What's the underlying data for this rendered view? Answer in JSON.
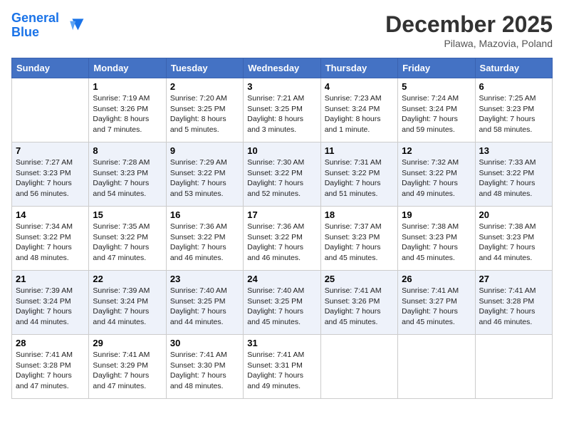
{
  "logo": {
    "line1": "General",
    "line2": "Blue"
  },
  "title": "December 2025",
  "location": "Pilawa, Mazovia, Poland",
  "days_of_week": [
    "Sunday",
    "Monday",
    "Tuesday",
    "Wednesday",
    "Thursday",
    "Friday",
    "Saturday"
  ],
  "weeks": [
    [
      {
        "day": "",
        "sunrise": "",
        "sunset": "",
        "daylight": ""
      },
      {
        "day": "1",
        "sunrise": "7:19 AM",
        "sunset": "3:26 PM",
        "daylight": "8 hours and 7 minutes."
      },
      {
        "day": "2",
        "sunrise": "7:20 AM",
        "sunset": "3:25 PM",
        "daylight": "8 hours and 5 minutes."
      },
      {
        "day": "3",
        "sunrise": "7:21 AM",
        "sunset": "3:25 PM",
        "daylight": "8 hours and 3 minutes."
      },
      {
        "day": "4",
        "sunrise": "7:23 AM",
        "sunset": "3:24 PM",
        "daylight": "8 hours and 1 minute."
      },
      {
        "day": "5",
        "sunrise": "7:24 AM",
        "sunset": "3:24 PM",
        "daylight": "7 hours and 59 minutes."
      },
      {
        "day": "6",
        "sunrise": "7:25 AM",
        "sunset": "3:23 PM",
        "daylight": "7 hours and 58 minutes."
      }
    ],
    [
      {
        "day": "7",
        "sunrise": "7:27 AM",
        "sunset": "3:23 PM",
        "daylight": "7 hours and 56 minutes."
      },
      {
        "day": "8",
        "sunrise": "7:28 AM",
        "sunset": "3:23 PM",
        "daylight": "7 hours and 54 minutes."
      },
      {
        "day": "9",
        "sunrise": "7:29 AM",
        "sunset": "3:22 PM",
        "daylight": "7 hours and 53 minutes."
      },
      {
        "day": "10",
        "sunrise": "7:30 AM",
        "sunset": "3:22 PM",
        "daylight": "7 hours and 52 minutes."
      },
      {
        "day": "11",
        "sunrise": "7:31 AM",
        "sunset": "3:22 PM",
        "daylight": "7 hours and 51 minutes."
      },
      {
        "day": "12",
        "sunrise": "7:32 AM",
        "sunset": "3:22 PM",
        "daylight": "7 hours and 49 minutes."
      },
      {
        "day": "13",
        "sunrise": "7:33 AM",
        "sunset": "3:22 PM",
        "daylight": "7 hours and 48 minutes."
      }
    ],
    [
      {
        "day": "14",
        "sunrise": "7:34 AM",
        "sunset": "3:22 PM",
        "daylight": "7 hours and 48 minutes."
      },
      {
        "day": "15",
        "sunrise": "7:35 AM",
        "sunset": "3:22 PM",
        "daylight": "7 hours and 47 minutes."
      },
      {
        "day": "16",
        "sunrise": "7:36 AM",
        "sunset": "3:22 PM",
        "daylight": "7 hours and 46 minutes."
      },
      {
        "day": "17",
        "sunrise": "7:36 AM",
        "sunset": "3:22 PM",
        "daylight": "7 hours and 46 minutes."
      },
      {
        "day": "18",
        "sunrise": "7:37 AM",
        "sunset": "3:23 PM",
        "daylight": "7 hours and 45 minutes."
      },
      {
        "day": "19",
        "sunrise": "7:38 AM",
        "sunset": "3:23 PM",
        "daylight": "7 hours and 45 minutes."
      },
      {
        "day": "20",
        "sunrise": "7:38 AM",
        "sunset": "3:23 PM",
        "daylight": "7 hours and 44 minutes."
      }
    ],
    [
      {
        "day": "21",
        "sunrise": "7:39 AM",
        "sunset": "3:24 PM",
        "daylight": "7 hours and 44 minutes."
      },
      {
        "day": "22",
        "sunrise": "7:39 AM",
        "sunset": "3:24 PM",
        "daylight": "7 hours and 44 minutes."
      },
      {
        "day": "23",
        "sunrise": "7:40 AM",
        "sunset": "3:25 PM",
        "daylight": "7 hours and 44 minutes."
      },
      {
        "day": "24",
        "sunrise": "7:40 AM",
        "sunset": "3:25 PM",
        "daylight": "7 hours and 45 minutes."
      },
      {
        "day": "25",
        "sunrise": "7:41 AM",
        "sunset": "3:26 PM",
        "daylight": "7 hours and 45 minutes."
      },
      {
        "day": "26",
        "sunrise": "7:41 AM",
        "sunset": "3:27 PM",
        "daylight": "7 hours and 45 minutes."
      },
      {
        "day": "27",
        "sunrise": "7:41 AM",
        "sunset": "3:28 PM",
        "daylight": "7 hours and 46 minutes."
      }
    ],
    [
      {
        "day": "28",
        "sunrise": "7:41 AM",
        "sunset": "3:28 PM",
        "daylight": "7 hours and 47 minutes."
      },
      {
        "day": "29",
        "sunrise": "7:41 AM",
        "sunset": "3:29 PM",
        "daylight": "7 hours and 47 minutes."
      },
      {
        "day": "30",
        "sunrise": "7:41 AM",
        "sunset": "3:30 PM",
        "daylight": "7 hours and 48 minutes."
      },
      {
        "day": "31",
        "sunrise": "7:41 AM",
        "sunset": "3:31 PM",
        "daylight": "7 hours and 49 minutes."
      },
      {
        "day": "",
        "sunrise": "",
        "sunset": "",
        "daylight": ""
      },
      {
        "day": "",
        "sunrise": "",
        "sunset": "",
        "daylight": ""
      },
      {
        "day": "",
        "sunrise": "",
        "sunset": "",
        "daylight": ""
      }
    ]
  ],
  "labels": {
    "sunrise": "Sunrise:",
    "sunset": "Sunset:",
    "daylight": "Daylight:"
  }
}
